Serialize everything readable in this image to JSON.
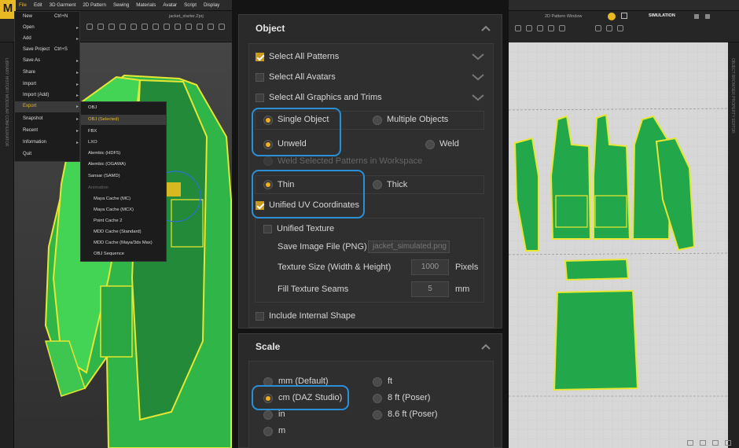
{
  "app": {
    "logo": "M",
    "file_title": "jacket_starter.Zprj",
    "pattern_window_title": "2D Pattern Window",
    "mode_label": "SIMULATION"
  },
  "menubar": [
    "File",
    "Edit",
    "3D Garment",
    "2D Pattern",
    "Sewing",
    "Materials",
    "Avatar",
    "Script",
    "Display"
  ],
  "file_menu": [
    {
      "label": "New",
      "shortcut": "Ctrl+N",
      "submenu": false
    },
    {
      "label": "Open",
      "shortcut": "",
      "submenu": true
    },
    {
      "label": "Add",
      "shortcut": "",
      "submenu": true
    },
    {
      "label": "Save Project",
      "shortcut": "Ctrl+S",
      "submenu": false
    },
    {
      "label": "Save As",
      "shortcut": "",
      "submenu": true
    },
    {
      "label": "Share",
      "shortcut": "",
      "submenu": true
    },
    {
      "label": "Import",
      "shortcut": "",
      "submenu": true
    },
    {
      "label": "Import (Add)",
      "shortcut": "",
      "submenu": true
    },
    {
      "label": "Export",
      "shortcut": "",
      "submenu": true
    },
    {
      "label": "Snapshot",
      "shortcut": "",
      "submenu": true
    },
    {
      "label": "Recent",
      "shortcut": "",
      "submenu": true
    },
    {
      "label": "Information",
      "shortcut": "",
      "submenu": true
    },
    {
      "label": "Quit",
      "shortcut": "",
      "submenu": false
    }
  ],
  "export_menu": {
    "items": [
      "OBJ",
      "OBJ (Selected)",
      "FBX",
      "LXO",
      "Alembic (HDF5)",
      "Alembic (OGAWA)",
      "Sansar (SAMD)"
    ],
    "animation_header": "Animation",
    "animation_items": [
      "Maya Cache (MC)",
      "Maya Cache (MCX)",
      "Point Cache 2",
      "MDD Cache (Standard)",
      "MDD Cache (Maya/3ds Max)",
      "OBJ Sequence"
    ]
  },
  "object_section": {
    "title": "Object",
    "select_all_patterns": "Select All Patterns",
    "select_all_avatars": "Select All Avatars",
    "select_all_graphics": "Select All Graphics and Trims",
    "single_object": "Single Object",
    "multiple_objects": "Multiple Objects",
    "unweld": "Unweld",
    "weld": "Weld",
    "weld_selected": "Weld Selected Patterns in Workspace",
    "thin": "Thin",
    "thick": "Thick",
    "unified_uv": "Unified UV Coordinates",
    "unified_texture": "Unified Texture",
    "save_image_file": "Save Image File (PNG)",
    "image_file_placeholder": "jacket_simulated.png",
    "texture_size_label": "Texture Size (Width & Height)",
    "texture_size_value": "1000",
    "texture_size_unit": "Pixels",
    "fill_seams_label": "Fill Texture Seams",
    "fill_seams_value": "5",
    "fill_seams_unit": "mm",
    "include_internal": "Include Internal Shape"
  },
  "scale_section": {
    "title": "Scale",
    "options": [
      "mm (Default)",
      "cm (DAZ Studio)",
      "in",
      "m",
      "ft",
      "8 ft (Poser)",
      "8.6 ft (Poser)"
    ],
    "selected": "cm (DAZ Studio)"
  },
  "side_labels": {
    "left": "LIBRARY   HISTORY   MODULAR CONFIGURATOR",
    "right": "OBJECT BROWSER   PROPERTY EDITOR"
  },
  "colors": {
    "accent": "#e8b923",
    "highlight": "#2a8fd6",
    "garment": "#22a84a",
    "seam": "#e6e633"
  }
}
